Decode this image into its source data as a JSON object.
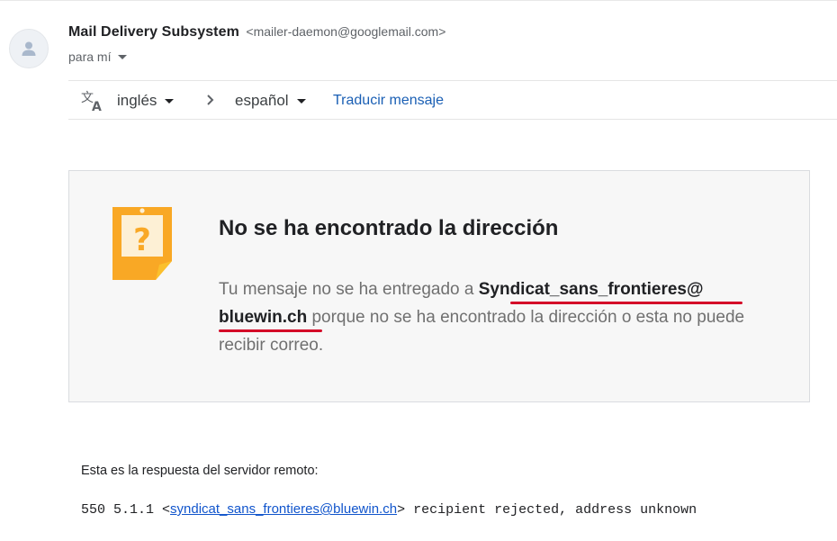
{
  "header": {
    "sender_name": "Mail Delivery Subsystem",
    "sender_email": "<mailer-daemon@googlemail.com>",
    "recipient_label": "para mí",
    "avatar_icon": "person-icon"
  },
  "translate": {
    "icon": "translate-icon",
    "from_language": "inglés",
    "to_language": "español",
    "translate_link": "Traducir mensaje"
  },
  "card": {
    "icon": "question-note-icon",
    "title": "No se ha encontrado la dirección",
    "body_prefix": "Tu mensaje no se ha entregado a ",
    "address_part1": "Syndicat_sans_frontieres@",
    "address_part2": "bluewin.ch",
    "body_suffix": " porque no se ha encontrado la dirección o esta no puede recibir correo."
  },
  "server": {
    "label": "Esta es la respuesta del servidor remoto:",
    "code": "550 5.1.1 <",
    "email_link": "syndicat_sans_frontieres@bluewin.ch",
    "message": "> recipient rejected, address unknown"
  },
  "colors": {
    "link": "#1a5fb4",
    "annotation_underline": "#d40a28",
    "note_orange": "#f9a825"
  }
}
